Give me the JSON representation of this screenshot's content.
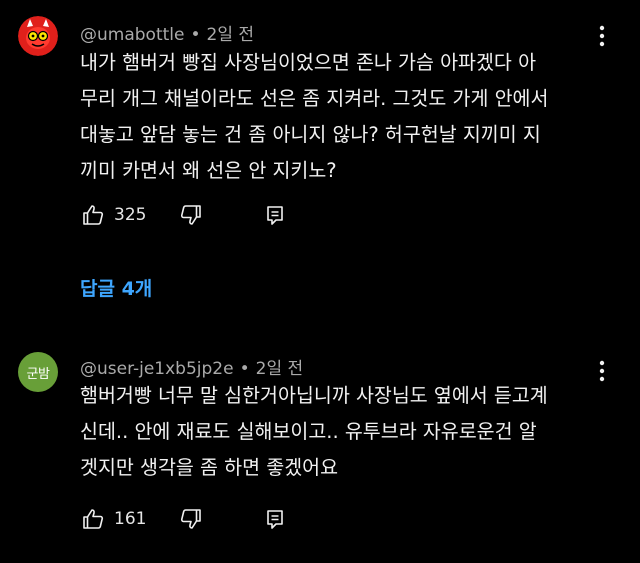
{
  "comments": [
    {
      "author": "@umabottle",
      "separator": "•",
      "time": "2일 전",
      "text": "내가 햄버거 빵집 사장님이었으면 존나 가슴 아파겠다 아\n무리 개그 채널이라도 선은 좀 지켜라. 그것도 가게 안에서\n대놓고 앞담 놓는 건 좀 아니지 않나? 허구헌날 지끼미 지\n끼미 카면서 왜 선은 안 지키노?",
      "likes": "325",
      "avatar_color": "#e0201b"
    },
    {
      "author": "@user-je1xb5jp2e",
      "separator": "•",
      "time": "2일 전",
      "text": "햄버거빵 너무 말 심한거아닙니까 사장님도 옆에서 듣고계\n신데.. 안에 재료도 실해보이고.. 유투브라 자유로운건 알\n겟지만 생각을 좀 하면 좋겠어요",
      "likes": "161",
      "avatar_initials": "군밤",
      "avatar_color": "#689f38"
    }
  ],
  "replies_label": "답글 4개",
  "icons": {
    "like": "thumb-up-icon",
    "dislike": "thumb-down-icon",
    "reply": "reply-icon",
    "more": "more-vert-icon"
  },
  "colors": {
    "background": "#000000",
    "text": "#f1f1f1",
    "meta": "#aaaaaa",
    "link": "#3ea6ff"
  }
}
